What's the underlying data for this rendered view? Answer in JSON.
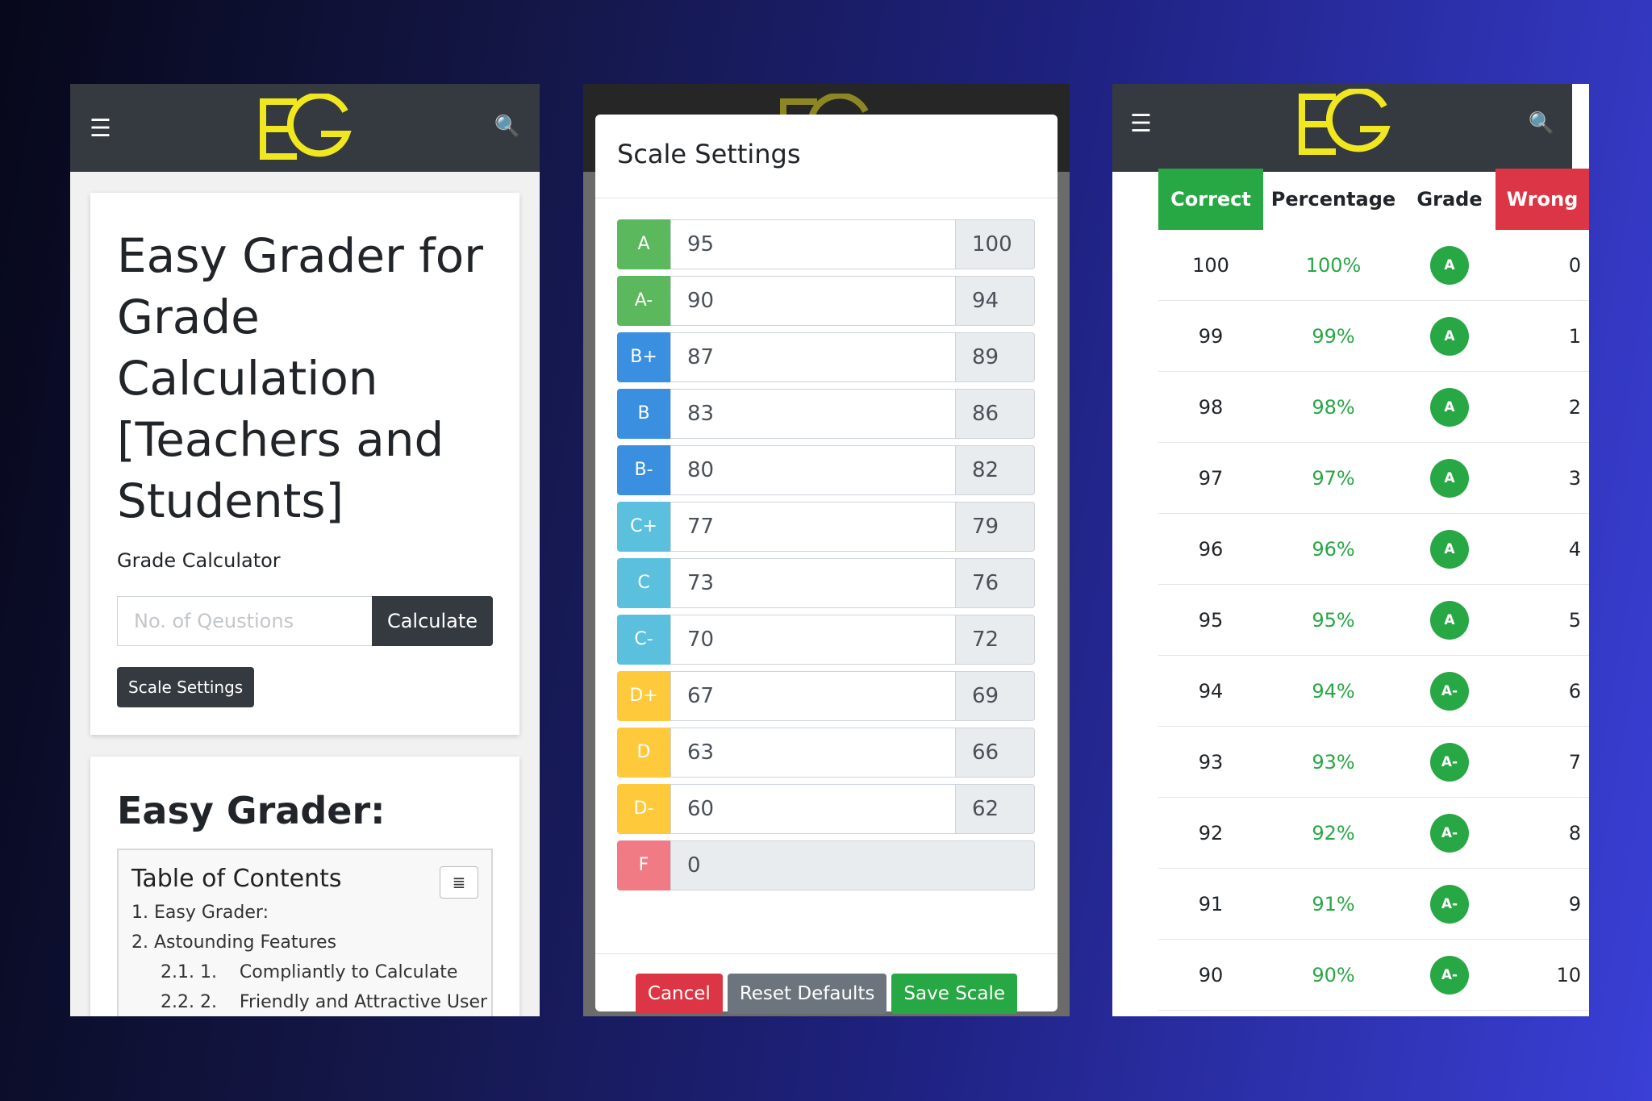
{
  "nav": {
    "menu_icon": "☰",
    "search_icon": "🔍"
  },
  "panel1": {
    "title": "Easy Grader for Grade Calculation [Teachers and Students]",
    "subtitle": "Grade Calculator",
    "input_placeholder": "No. of Qeustions",
    "calculate_label": "Calculate",
    "scale_settings_label": "Scale Settings",
    "section_heading": "Easy Grader:",
    "toc": {
      "title": "Table of Contents",
      "items": [
        "1. Easy Grader:",
        "2. Astounding Features",
        "2.1. 1.    Compliantly to Calculate",
        "2.2. 2.    Friendly and Attractive User"
      ]
    }
  },
  "panel2": {
    "modal_title": "Scale Settings",
    "scale": [
      {
        "grade": "A",
        "min": "95",
        "max": "100",
        "color": "#5cb85c"
      },
      {
        "grade": "A-",
        "min": "90",
        "max": "94",
        "color": "#5cb85c"
      },
      {
        "grade": "B+",
        "min": "87",
        "max": "89",
        "color": "#3b8fe0"
      },
      {
        "grade": "B",
        "min": "83",
        "max": "86",
        "color": "#3b8fe0"
      },
      {
        "grade": "B-",
        "min": "80",
        "max": "82",
        "color": "#3b8fe0"
      },
      {
        "grade": "C+",
        "min": "77",
        "max": "79",
        "color": "#5bc0de"
      },
      {
        "grade": "C",
        "min": "73",
        "max": "76",
        "color": "#5bc0de"
      },
      {
        "grade": "C-",
        "min": "70",
        "max": "72",
        "color": "#5bc0de"
      },
      {
        "grade": "D+",
        "min": "67",
        "max": "69",
        "color": "#ffc93c"
      },
      {
        "grade": "D",
        "min": "63",
        "max": "66",
        "color": "#ffc93c"
      },
      {
        "grade": "D-",
        "min": "60",
        "max": "62",
        "color": "#ffc93c"
      },
      {
        "grade": "F",
        "min": "0",
        "max": "",
        "color": "#f07b85"
      }
    ],
    "cancel_label": "Cancel",
    "reset_label": "Reset Defaults",
    "save_label": "Save Scale"
  },
  "panel3": {
    "headers": {
      "correct": "Correct",
      "percentage": "Percentage",
      "grade": "Grade",
      "wrong": "Wrong"
    },
    "header_colors": {
      "correct": "#28a745",
      "wrong": "#dc3545"
    },
    "rows": [
      {
        "correct": "100",
        "pct": "100%",
        "grade": "A",
        "wrong": "0"
      },
      {
        "correct": "99",
        "pct": "99%",
        "grade": "A",
        "wrong": "1"
      },
      {
        "correct": "98",
        "pct": "98%",
        "grade": "A",
        "wrong": "2"
      },
      {
        "correct": "97",
        "pct": "97%",
        "grade": "A",
        "wrong": "3"
      },
      {
        "correct": "96",
        "pct": "96%",
        "grade": "A",
        "wrong": "4"
      },
      {
        "correct": "95",
        "pct": "95%",
        "grade": "A",
        "wrong": "5"
      },
      {
        "correct": "94",
        "pct": "94%",
        "grade": "A-",
        "wrong": "6"
      },
      {
        "correct": "93",
        "pct": "93%",
        "grade": "A-",
        "wrong": "7"
      },
      {
        "correct": "92",
        "pct": "92%",
        "grade": "A-",
        "wrong": "8"
      },
      {
        "correct": "91",
        "pct": "91%",
        "grade": "A-",
        "wrong": "9"
      },
      {
        "correct": "90",
        "pct": "90%",
        "grade": "A-",
        "wrong": "10"
      }
    ]
  }
}
